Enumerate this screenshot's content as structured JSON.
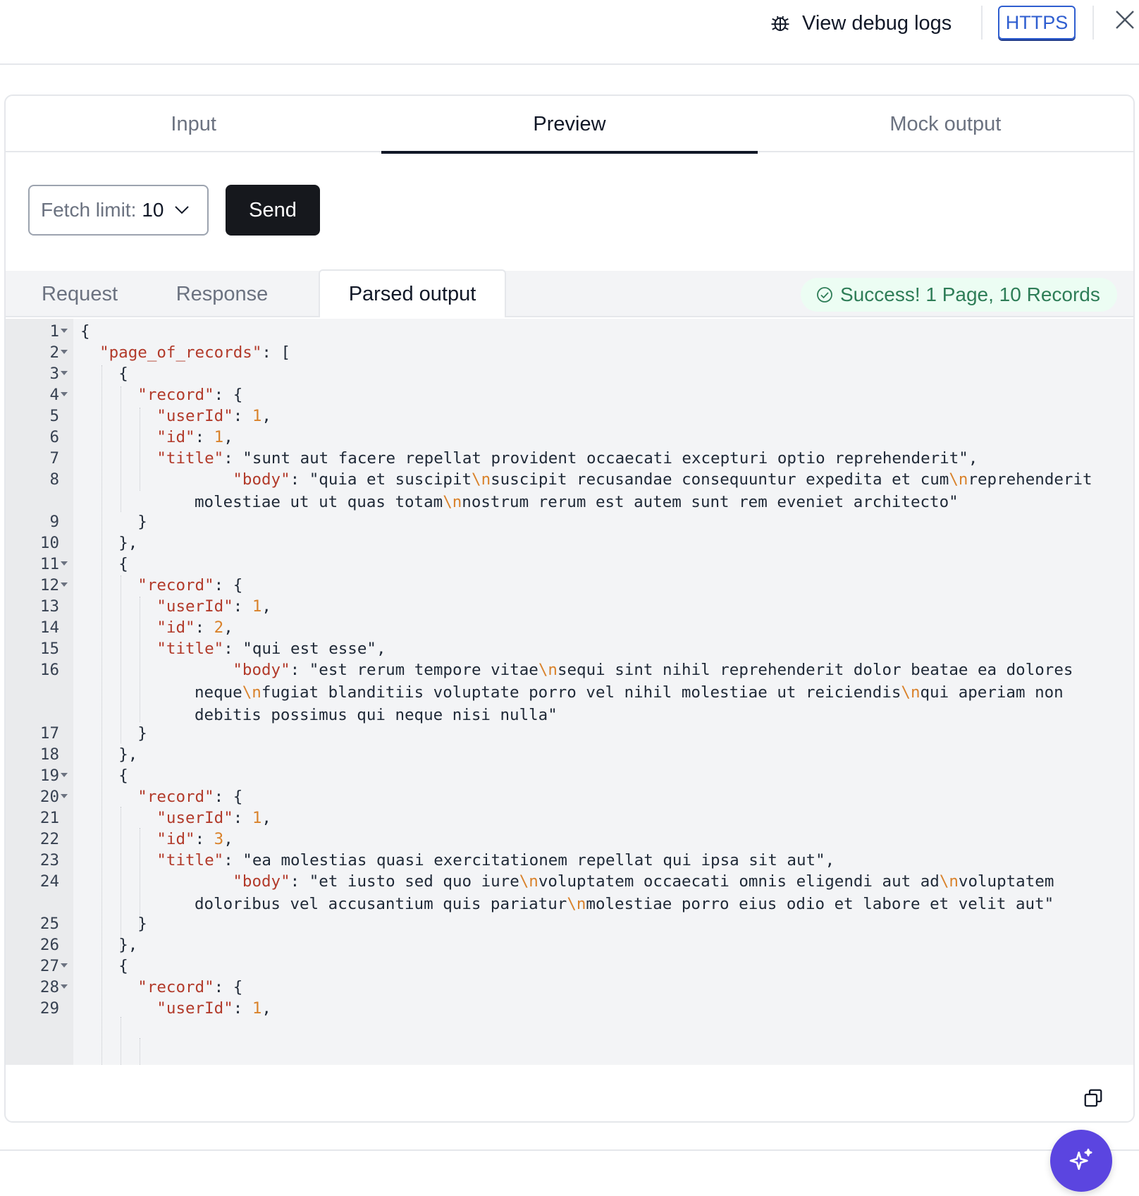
{
  "header": {
    "debug_label": "View debug logs",
    "protocol_badge": "HTTPS",
    "icons": {
      "debug": "bug-icon",
      "close": "close-icon"
    }
  },
  "main_tabs": [
    {
      "label": "Input",
      "active": false
    },
    {
      "label": "Preview",
      "active": true
    },
    {
      "label": "Mock output",
      "active": false
    }
  ],
  "controls": {
    "fetch_limit_label": "Fetch limit:",
    "fetch_limit_value": "10",
    "send_label": "Send"
  },
  "sub_tabs": [
    {
      "label": "Request",
      "active": false
    },
    {
      "label": "Response",
      "active": false
    },
    {
      "label": "Parsed output",
      "active": true
    }
  ],
  "status": {
    "text": "Success! 1 Page, 10 Records",
    "color": "#2e7d57"
  },
  "code": {
    "line_numbers": [
      "1",
      "2",
      "3",
      "4",
      "5",
      "6",
      "7",
      "8",
      "9",
      "10",
      "11",
      "12",
      "13",
      "14",
      "15",
      "16",
      "17",
      "18",
      "19",
      "20",
      "21",
      "22",
      "23",
      "24",
      "25",
      "26",
      "27",
      "28",
      "29"
    ],
    "records": [
      {
        "userId": "1",
        "id": "1",
        "title": "\"sunt aut facere repellat provident occaecati excepturi optio reprehenderit\"",
        "body_parts": [
          "\"quia et suscipit",
          "suscipit recusandae consequuntur expedita et cum",
          "reprehenderit molestiae ut ut quas totam",
          "nostrum rerum est autem sunt rem eveniet architecto\""
        ]
      },
      {
        "userId": "1",
        "id": "2",
        "title": "\"qui est esse\"",
        "body_parts": [
          "\"est rerum tempore vitae",
          "sequi sint nihil reprehenderit dolor beatae ea dolores neque",
          "fugiat blanditiis voluptate porro vel nihil molestiae ut reiciendis",
          "qui aperiam non debitis possimus qui neque nisi nulla\""
        ]
      },
      {
        "userId": "1",
        "id": "3",
        "title": "\"ea molestias quasi exercitationem repellat qui ipsa sit aut\"",
        "body_parts": [
          "\"et iusto sed quo iure",
          "voluptatem occaecati omnis eligendi aut ad",
          "voluptatem doloribus vel accusantium quis pariatur",
          "molestiae porro eius odio et labore et velit aut\""
        ]
      },
      {
        "userId": "1"
      }
    ],
    "keys": {
      "root": "\"page_of_records\"",
      "record": "\"record\"",
      "userId": "\"userId\"",
      "id": "\"id\"",
      "title": "\"title\"",
      "body": "\"body\""
    },
    "escape": "\\n"
  },
  "footer": {
    "copy_icon": "copy-icon",
    "assistant_icon": "sparkle-icon",
    "assistant_color": "#5b45e0"
  }
}
